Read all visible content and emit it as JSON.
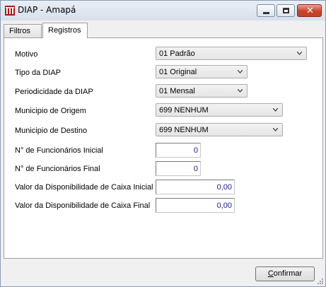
{
  "window": {
    "title": "DIAP - Amapá"
  },
  "tabs": [
    {
      "label": "Filtros",
      "active": false
    },
    {
      "label": "Registros",
      "active": true
    }
  ],
  "form": {
    "motivo": {
      "label": "Motivo",
      "value": "01 Padrão"
    },
    "tipo_diap": {
      "label": "Tipo da DIAP",
      "value": "01 Original"
    },
    "periodicidade": {
      "label": "Periodicidade da DIAP",
      "value": "01 Mensal"
    },
    "municipio_origem": {
      "label": "Municipio de Origem",
      "value": "699 NENHUM"
    },
    "municipio_destino": {
      "label": "Municipio de Destino",
      "value": "699 NENHUM"
    },
    "func_inicial": {
      "label": "N° de Funcionários Inicial",
      "value": "0"
    },
    "func_final": {
      "label": "N° de Funcionários Final",
      "value": "0"
    },
    "caixa_inicial": {
      "label": "Valor da Disponibilidade de Caixa Inicial",
      "value": "0,00"
    },
    "caixa_final": {
      "label": "Valor da Disponibilidade de Caixa Final",
      "value": "0,00"
    }
  },
  "footer": {
    "confirm_accel": "C",
    "confirm_rest": "onfirmar"
  },
  "colors": {
    "input_text": "#1a1a8c",
    "close_button": "#c9432b"
  },
  "icons": [
    "app-icon",
    "minimize-icon",
    "maximize-icon",
    "close-icon",
    "dropdown-arrow-icon",
    "resize-grip-icon"
  ]
}
